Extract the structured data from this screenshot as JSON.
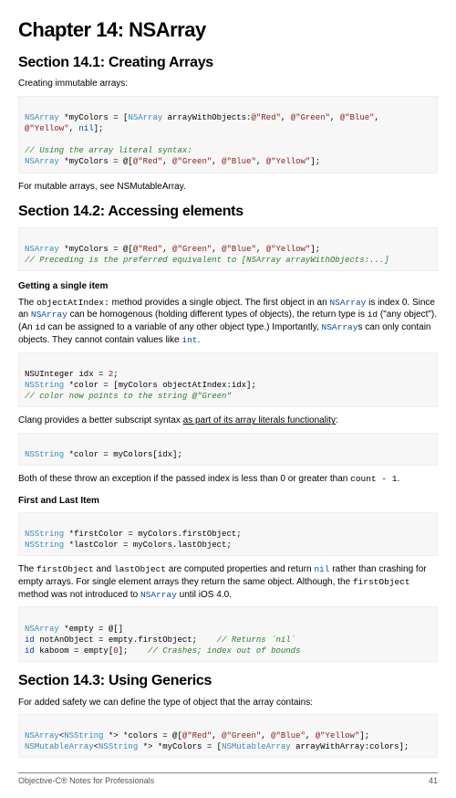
{
  "chapter": {
    "title": "Chapter 14: NSArray"
  },
  "s1": {
    "heading": "Section 14.1: Creating Arrays",
    "intro": "Creating immutable arrays:",
    "c1a": "NSArray *myColors = [NSArray arrayWithObjects:@\"Red\", @\"Green\", @\"Blue\", @\"Yellow\", nil];",
    "c1b_cm": "// Using the array literal syntax:",
    "c1b": "NSArray *myColors = @[@\"Red\", @\"Green\", @\"Blue\", @\"Yellow\"];",
    "outro": "For mutable arrays, see NSMutableArray."
  },
  "s2": {
    "heading": "Section 14.2: Accessing elements",
    "c1a": "NSArray *myColors = @[@\"Red\", @\"Green\", @\"Blue\", @\"Yellow\"];",
    "c1b_cm": "// Preceding is the preferred equivalent to [NSArray arrayWithObjects:...]",
    "h_single": "Getting a single item",
    "p1a": "The ",
    "p1_m1": "objectAtIndex:",
    "p1b": " method provides a single object. The first object in an ",
    "p1_l1": "NSArray",
    "p1c": " is index 0. Since an ",
    "p1_l2": "NSArray",
    "p1d": " can be homogenous (holding different types of objects), the return type is ",
    "p1_m2": "id",
    "p1e": " (\"any object\"). (An ",
    "p1_m3": "id",
    "p1f": " can be assigned to a variable of any other object type.) Importantly, ",
    "p1_l3": "NSArray",
    "p1g": "s can only contain objects. They cannot contain values like ",
    "p1_l4": "int",
    "p1h": ".",
    "c2a": "NSUInteger idx = 2;",
    "c2b": "NSString *color = [myColors objectAtIndex:idx];",
    "c2c_cm": "// color now points to the string @\"Green\"",
    "p2a": "Clang provides a better subscript syntax ",
    "p2u": "as part of its array literals functionality",
    "p2b": ":",
    "c3": "NSString *color = myColors[idx];",
    "p3a": "Both of these throw an exception if the passed index is less than 0 or greater than ",
    "p3m": "count - 1",
    "p3b": ".",
    "h_fl": "First and Last Item",
    "c4a": "NSString *firstColor = myColors.firstObject;",
    "c4b": "NSString *lastColor = myColors.lastObject;",
    "p4a": "The ",
    "p4m1": "firstObject",
    "p4b": " and ",
    "p4m2": "lastObject",
    "p4c": " are computed properties and return ",
    "p4l1": "nil",
    "p4d": " rather than crashing for empty arrays. For single element arrays they return the same object. Although, the ",
    "p4m3": "firstObject",
    "p4e": " method was not introduced to ",
    "p4l2": "NSArray",
    "p4f": " until iOS 4.0.",
    "c5a": "NSArray *empty = @[]",
    "c5b": "id notAnObject = empty.firstObject;    ",
    "c5b_cm": "// Returns `nil`",
    "c5c": "id kaboom = empty[0];    ",
    "c5c_cm": "// Crashes; index out of bounds"
  },
  "s3": {
    "heading": "Section 14.3: Using Generics",
    "intro": "For added safety we can define the type of object that the array contains:",
    "c1a": "NSArray<NSString *> *colors = @[@\"Red\", @\"Green\", @\"Blue\", @\"Yellow\"];",
    "c1b": "NSMutableArray<NSString *> *myColors = [NSMutableArray arrayWithArray:colors];"
  },
  "footer": {
    "left": "Objective-C® Notes for Professionals",
    "right": "41"
  }
}
